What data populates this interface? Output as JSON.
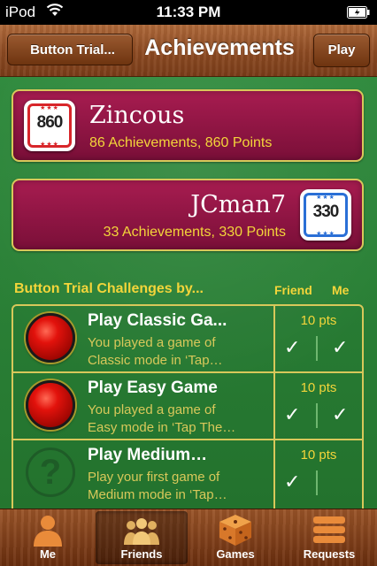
{
  "status_bar": {
    "carrier": "iPod",
    "time": "11:33 PM"
  },
  "nav": {
    "back_label": "Button Trial...",
    "title": "Achievements",
    "play_label": "Play"
  },
  "players": {
    "me": {
      "name": "Zincous",
      "stats": "86 Achievements, 860 Points",
      "badge_points": "860",
      "badge_color": "#d8262a"
    },
    "friend": {
      "name": "JCman7",
      "stats": "33 Achievements, 330 Points",
      "badge_points": "330",
      "badge_color": "#2a6fd6"
    }
  },
  "challenges": {
    "header": "Button Trial Challenges by...",
    "col_friend": "Friend",
    "col_me": "Me",
    "items": [
      {
        "title": "Play Classic Ga...",
        "desc_line1": "You played a game of",
        "desc_line2": "Classic mode in ‘Tap…",
        "points": "10 pts",
        "icon": "red-button-icon",
        "friend_check": "✓",
        "me_check": "✓"
      },
      {
        "title": "Play Easy Game",
        "desc_line1": "You played a game of",
        "desc_line2": "Easy mode in ‘Tap The…",
        "points": "10 pts",
        "icon": "red-button-icon",
        "friend_check": "✓",
        "me_check": "✓"
      },
      {
        "title": "Play Medium…",
        "desc_line1": "Play your first game of",
        "desc_line2": "Medium mode in ‘Tap…",
        "points": "10 pts",
        "icon": "question-mark-icon",
        "friend_check": "✓",
        "me_check": ""
      }
    ]
  },
  "tabs": [
    {
      "label": "Me",
      "icon": "person-icon",
      "active": false
    },
    {
      "label": "Friends",
      "icon": "friends-icon",
      "active": true
    },
    {
      "label": "Games",
      "icon": "dice-icon",
      "active": false
    },
    {
      "label": "Requests",
      "icon": "requests-icon",
      "active": false
    }
  ]
}
